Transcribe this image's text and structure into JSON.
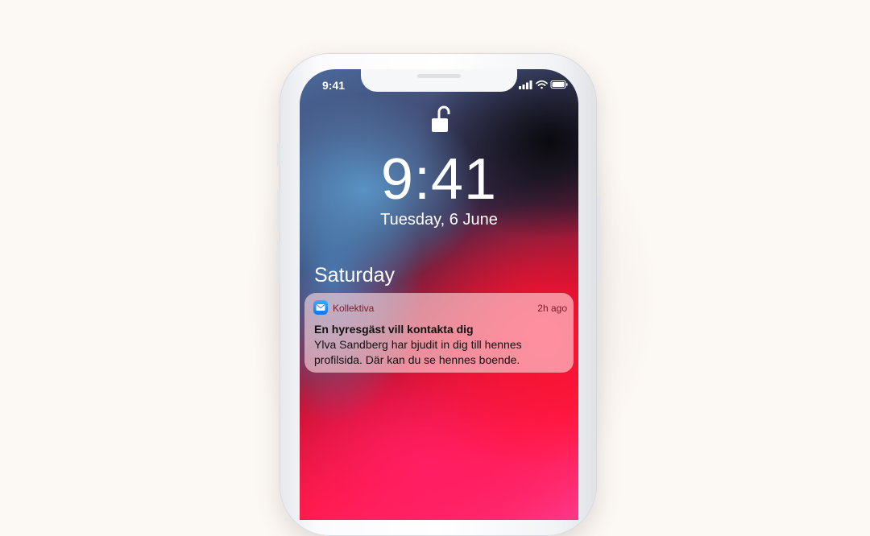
{
  "status_bar": {
    "time": "9:41"
  },
  "lock_screen": {
    "clock": "9:41",
    "date": "Tuesday, 6 June",
    "section_header": "Saturday"
  },
  "notification": {
    "app_name": "Kollektiva",
    "time_ago": "2h ago",
    "title": "En hyresgäst vill kontakta dig",
    "body": "Ylva Sandberg har bjudit in dig till hennes profilsida. Där kan du se hennes boende."
  }
}
